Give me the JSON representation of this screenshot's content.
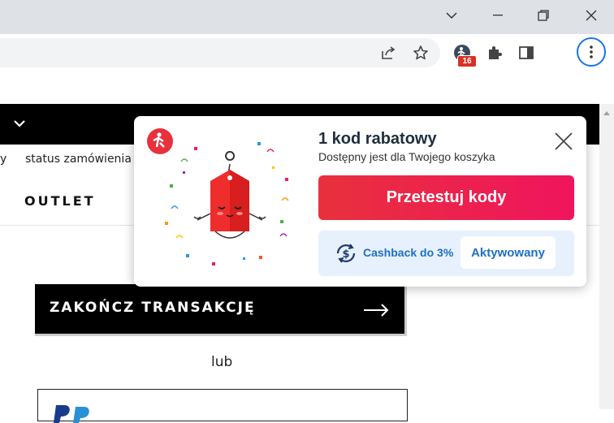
{
  "window": {
    "controls": {
      "tabs_dropdown": "chevron-down-icon",
      "minimize": "minimize-icon",
      "restore": "restore-icon",
      "close": "close-icon"
    }
  },
  "toolbar": {
    "extension_badge": "16",
    "icons": [
      "share-icon",
      "star-icon",
      "extension-icon",
      "puzzle-icon",
      "side-panel-icon",
      "kebab-menu-icon"
    ]
  },
  "page": {
    "nav_partial": "y",
    "nav_status": "status zamówienia",
    "outlet": "OUTLET",
    "checkout_button": "ZAKOŃCZ TRANSAKCJĘ",
    "or_text": "lub"
  },
  "popup": {
    "title": "1 kod rabatowy",
    "subtitle": "Dostępny jest dla Twojego koszyka",
    "try_button": "Przetestuj kody",
    "cashback_text": "Cashback do 3%",
    "activated_label": "Aktywowany"
  },
  "colors": {
    "brand_red": "#e8313c",
    "brand_pink": "#f0145e",
    "cashback_blue": "#1f6fc5",
    "cashback_bg": "#e7f1fd"
  }
}
